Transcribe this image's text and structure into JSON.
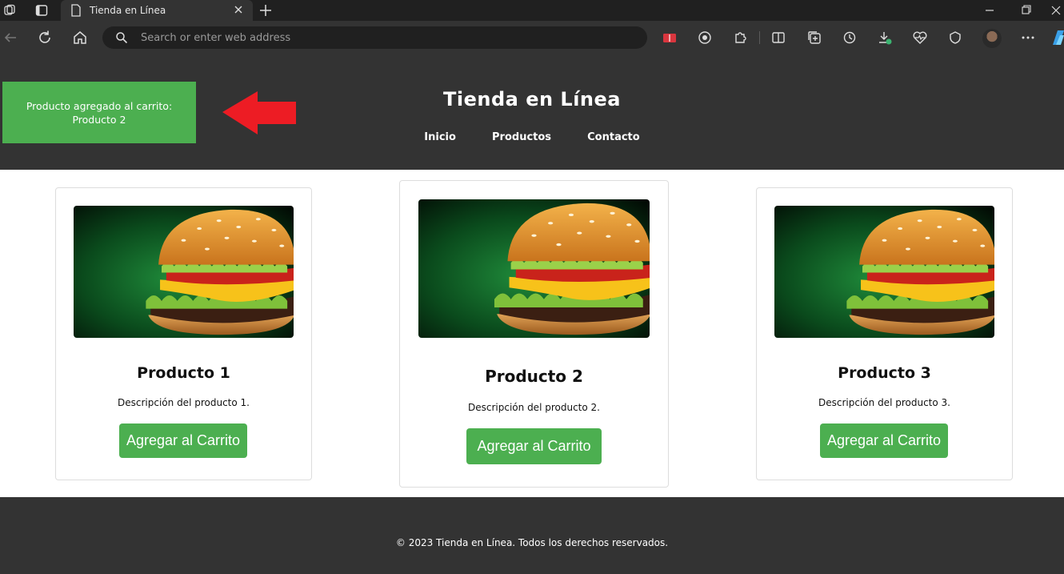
{
  "browser": {
    "tab_title": "Tienda en Línea",
    "address_placeholder": "Search or enter web address"
  },
  "site": {
    "title": "Tienda en Línea",
    "nav": [
      "Inicio",
      "Productos",
      "Contacto"
    ],
    "toast_line1": "Producto agregado al carrito:",
    "toast_line2": "Producto 2",
    "footer": "© 2023 Tienda en Línea. Todos los derechos reservados."
  },
  "products": [
    {
      "name": "Producto 1",
      "description": "Descripción del producto 1.",
      "button": "Agregar al Carrito"
    },
    {
      "name": "Producto 2",
      "description": "Descripción del producto 2.",
      "button": "Agregar al Carrito"
    },
    {
      "name": "Producto 3",
      "description": "Descripción del producto 3.",
      "button": "Agregar al Carrito"
    }
  ],
  "colors": {
    "header_bg": "#333333",
    "accent_green": "#4caf50",
    "arrow_red": "#ed1c24"
  }
}
